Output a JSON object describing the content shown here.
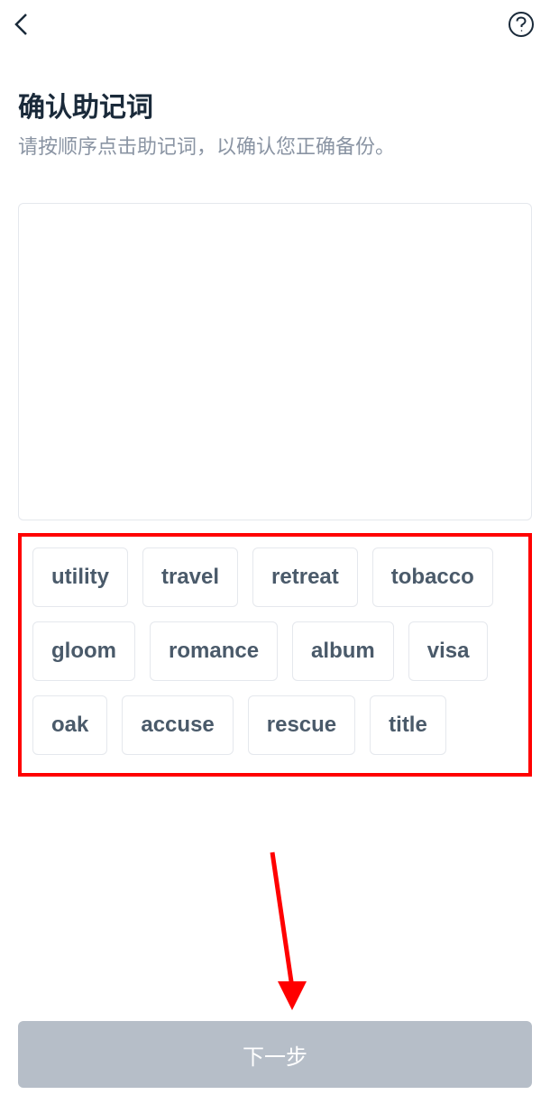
{
  "header": {
    "back_icon": "chevron-left",
    "help_icon": "question-circle"
  },
  "page": {
    "title": "确认助记词",
    "subtitle": "请按顺序点击助记词，以确认您正确备份。"
  },
  "words": {
    "row1": [
      "utility",
      "travel",
      "retreat",
      "tobacco"
    ],
    "row2": [
      "gloom",
      "romance",
      "album",
      "visa"
    ],
    "row3": [
      "oak",
      "accuse",
      "rescue",
      "title"
    ]
  },
  "footer": {
    "next_label": "下一步"
  },
  "annotations": {
    "highlight_color": "#ff0000",
    "arrow_color": "#ff0000"
  }
}
